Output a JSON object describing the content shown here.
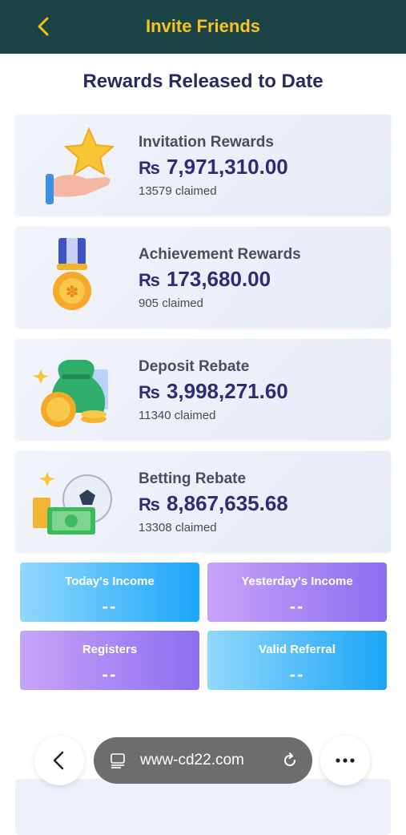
{
  "header": {
    "title": "Invite Friends"
  },
  "main": {
    "heading": "Rewards Released to Date",
    "cards": [
      {
        "name": "Invitation Rewards",
        "currency": "₨",
        "amount": "7,971,310.00",
        "claimed": "13579 claimed",
        "icon": "hand-star-icon"
      },
      {
        "name": "Achievement Rewards",
        "currency": "₨",
        "amount": "173,680.00",
        "claimed": "905 claimed",
        "icon": "medal-icon"
      },
      {
        "name": "Deposit Rebate",
        "currency": "₨",
        "amount": "3,998,271.60",
        "claimed": "11340 claimed",
        "icon": "money-bag-icon"
      },
      {
        "name": "Betting Rebate",
        "currency": "₨",
        "amount": "8,867,635.68",
        "claimed": "13308 claimed",
        "icon": "football-cash-icon"
      }
    ],
    "stats": [
      {
        "label": "Today's Income",
        "value": "--"
      },
      {
        "label": "Yesterday's Income",
        "value": "--"
      },
      {
        "label": "Registers",
        "value": "--"
      },
      {
        "label": "Valid Referral",
        "value": "--"
      }
    ]
  },
  "browser": {
    "url": "www-cd22.com"
  },
  "colors": {
    "header_bg": "#1c4444",
    "title": "#f5c324",
    "amount": "#2f2c77"
  }
}
